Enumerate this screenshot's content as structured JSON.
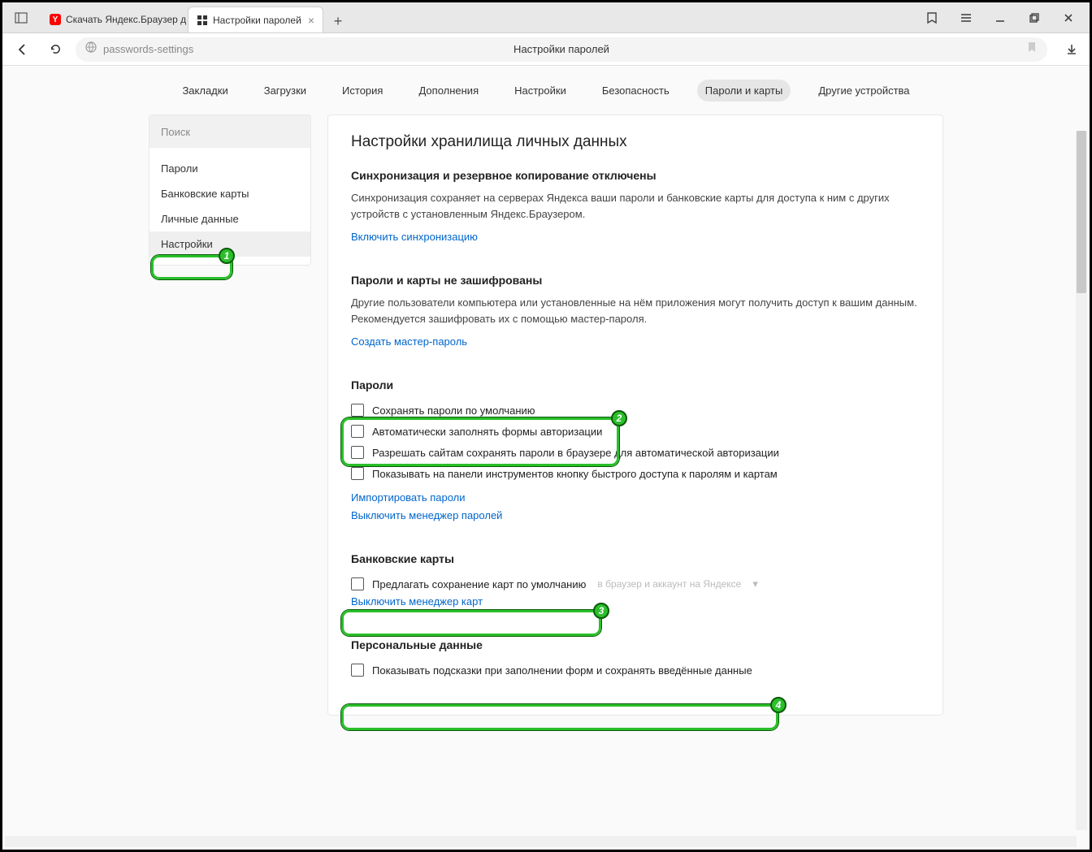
{
  "titlebar": {
    "tabs": [
      {
        "label": "Скачать Яндекс.Браузер д",
        "active": false
      },
      {
        "label": "Настройки паролей",
        "active": true
      }
    ]
  },
  "addressbar": {
    "url": "passwords-settings",
    "page_title": "Настройки паролей"
  },
  "top_nav": {
    "items": [
      "Закладки",
      "Загрузки",
      "История",
      "Дополнения",
      "Настройки",
      "Безопасность",
      "Пароли и карты",
      "Другие устройства"
    ],
    "active_index": 6
  },
  "sidebar": {
    "search_placeholder": "Поиск",
    "items": [
      "Пароли",
      "Банковские карты",
      "Личные данные",
      "Настройки"
    ],
    "selected_index": 3
  },
  "panel": {
    "title": "Настройки хранилища личных данных",
    "sync": {
      "head": "Синхронизация и резервное копирование отключены",
      "desc": "Синхронизация сохраняет на серверах Яндекса ваши пароли и банковские карты для доступа к ним с других устройств с установленным Яндекс.Браузером.",
      "link": "Включить синхронизацию"
    },
    "encrypt": {
      "head": "Пароли и карты не зашифрованы",
      "desc": "Другие пользователи компьютера или установленные на нём приложения могут получить доступ к вашим данным. Рекомендуется зашифровать их с помощью мастер-пароля.",
      "link": "Создать мастер-пароль"
    },
    "passwords": {
      "head": "Пароли",
      "chk1": "Сохранять пароли по умолчанию",
      "chk2": "Автоматически заполнять формы авторизации",
      "chk3": "Разрешать сайтам сохранять пароли в браузере для автоматической авторизации",
      "chk4": "Показывать на панели инструментов кнопку быстрого доступа к паролям и картам",
      "link1": "Импортировать пароли",
      "link2": "Выключить менеджер паролей"
    },
    "cards": {
      "head": "Банковские карты",
      "chk1": "Предлагать сохранение карт по умолчанию",
      "hint": "в браузер и аккаунт на Яндексе",
      "link": "Выключить менеджер карт"
    },
    "personal": {
      "head": "Персональные данные",
      "chk1": "Показывать подсказки при заполнении форм и сохранять введённые данные"
    }
  },
  "annotations": {
    "b1": "1",
    "b2": "2",
    "b3": "3",
    "b4": "4"
  }
}
